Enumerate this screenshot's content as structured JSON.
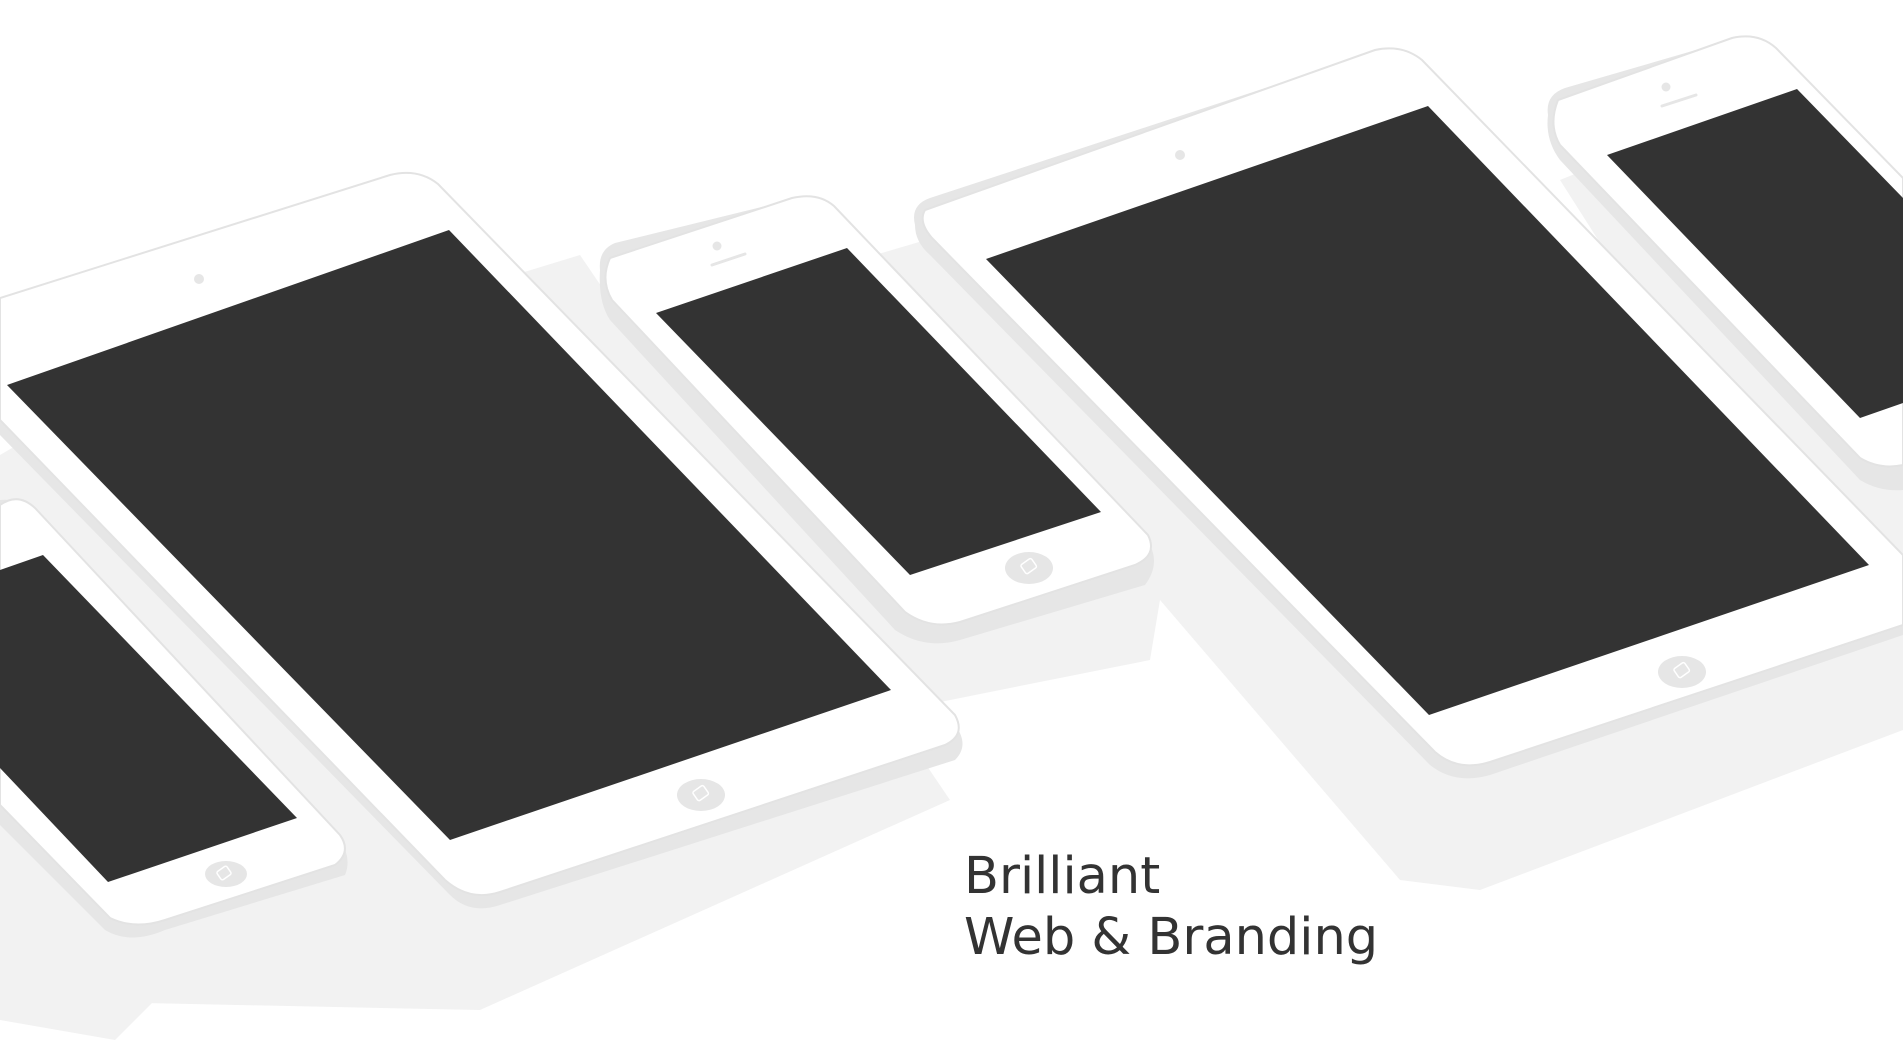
{
  "hero": {
    "line1": "Brilliant",
    "line2": "Web & Branding"
  },
  "devices": [
    {
      "kind": "tablet",
      "name": "tablet-left"
    },
    {
      "kind": "phone",
      "name": "phone-center"
    },
    {
      "kind": "tablet",
      "name": "tablet-right"
    },
    {
      "kind": "phone",
      "name": "phone-top-right"
    },
    {
      "kind": "phone",
      "name": "phone-bottom-left"
    }
  ],
  "colors": {
    "background": "#ffffff",
    "device_body": "#ffffff",
    "device_edge": "#e6e6e6",
    "shadow": "#f2f2f2",
    "screen": "#333333",
    "text": "#333333"
  }
}
